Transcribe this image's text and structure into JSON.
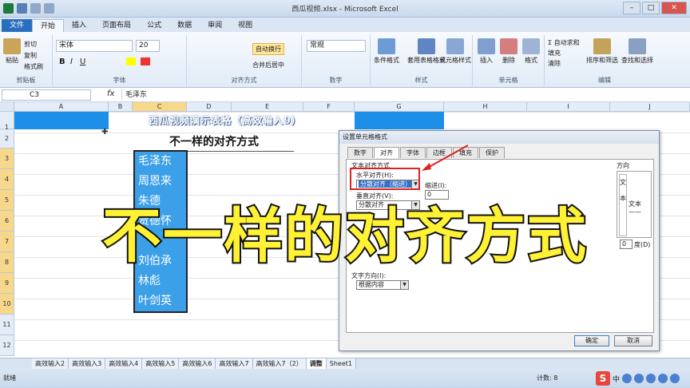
{
  "window": {
    "title": "西瓜视频.xlsx - Microsoft Excel"
  },
  "ribbon": {
    "tabs": [
      "文件",
      "开始",
      "插入",
      "页面布局",
      "公式",
      "数据",
      "审阅",
      "视图"
    ],
    "clipboard": {
      "paste": "粘贴",
      "cut": "剪切",
      "copy": "复制",
      "format_painter": "格式刷",
      "label": "剪贴板"
    },
    "font": {
      "name": "宋体",
      "size": "20",
      "label": "字体"
    },
    "alignment": {
      "wrap": "自动换行",
      "merge": "合并后居中",
      "label": "对齐方式"
    },
    "number": {
      "format": "常规",
      "label": "数字"
    },
    "styles": {
      "conditional": "条件格式",
      "table": "套用表格格式",
      "cell_styles": "单元格样式",
      "label": "样式"
    },
    "cells": {
      "insert": "插入",
      "delete": "删除",
      "format": "格式",
      "label": "单元格"
    },
    "editing": {
      "autosum": "自动求和",
      "fill": "填充",
      "clear": "清除",
      "sort": "排序和筛选",
      "find": "查找和选择",
      "label": "编辑"
    }
  },
  "formula_bar": {
    "name_box": "C3",
    "fx": "fx",
    "content": "毛泽东"
  },
  "grid": {
    "columns": [
      "A",
      "B",
      "C",
      "D",
      "E",
      "F",
      "G",
      "H",
      "I",
      "J"
    ],
    "rows": [
      "1",
      "2",
      "3",
      "4",
      "5",
      "6",
      "7",
      "8",
      "9",
      "10",
      "11",
      "12"
    ],
    "banner": "西瓜视频演示表格（高效输入9）",
    "header": "不一样的对齐方式",
    "names": [
      "毛泽东",
      "周恩来",
      "朱德",
      "贺德怀",
      "",
      "刘伯承",
      "林彪",
      "叶剑英"
    ]
  },
  "dialog": {
    "title": "设置单元格格式",
    "tabs": [
      "数字",
      "对齐",
      "字体",
      "边框",
      "填充",
      "保护"
    ],
    "section_align": "文本对齐方式",
    "horizontal_label": "水平对齐(H):",
    "horizontal_value": "分散对齐（缩进）",
    "indent_label": "缩进(I):",
    "indent_value": "0",
    "vertical_label": "垂直对齐(V):",
    "vertical_value": "分散对齐",
    "text_direction_label": "文字方向(I):",
    "text_direction_value": "根据内容",
    "orientation_label": "方向",
    "orientation_vertical": "文本",
    "orientation_text": "文本 ——",
    "degree": "0",
    "degree_label": "度(D)",
    "ok": "确定",
    "cancel": "取消"
  },
  "caption": "不一样的对齐方式",
  "sheet_tabs": [
    "高效输入2",
    "高效输入3",
    "高效输入4",
    "高效输入5",
    "高效输入6",
    "高效输入7",
    "高效输入7（2）",
    "调整",
    "Sheet1"
  ],
  "status": {
    "ready": "就绪",
    "count": "计数: 8",
    "ime_logo": "S",
    "ime_lang": "中"
  },
  "colors": {
    "accent_blue": "#1e8fe8",
    "caption_yellow": "#fff134",
    "red_box": "#dd2222"
  }
}
